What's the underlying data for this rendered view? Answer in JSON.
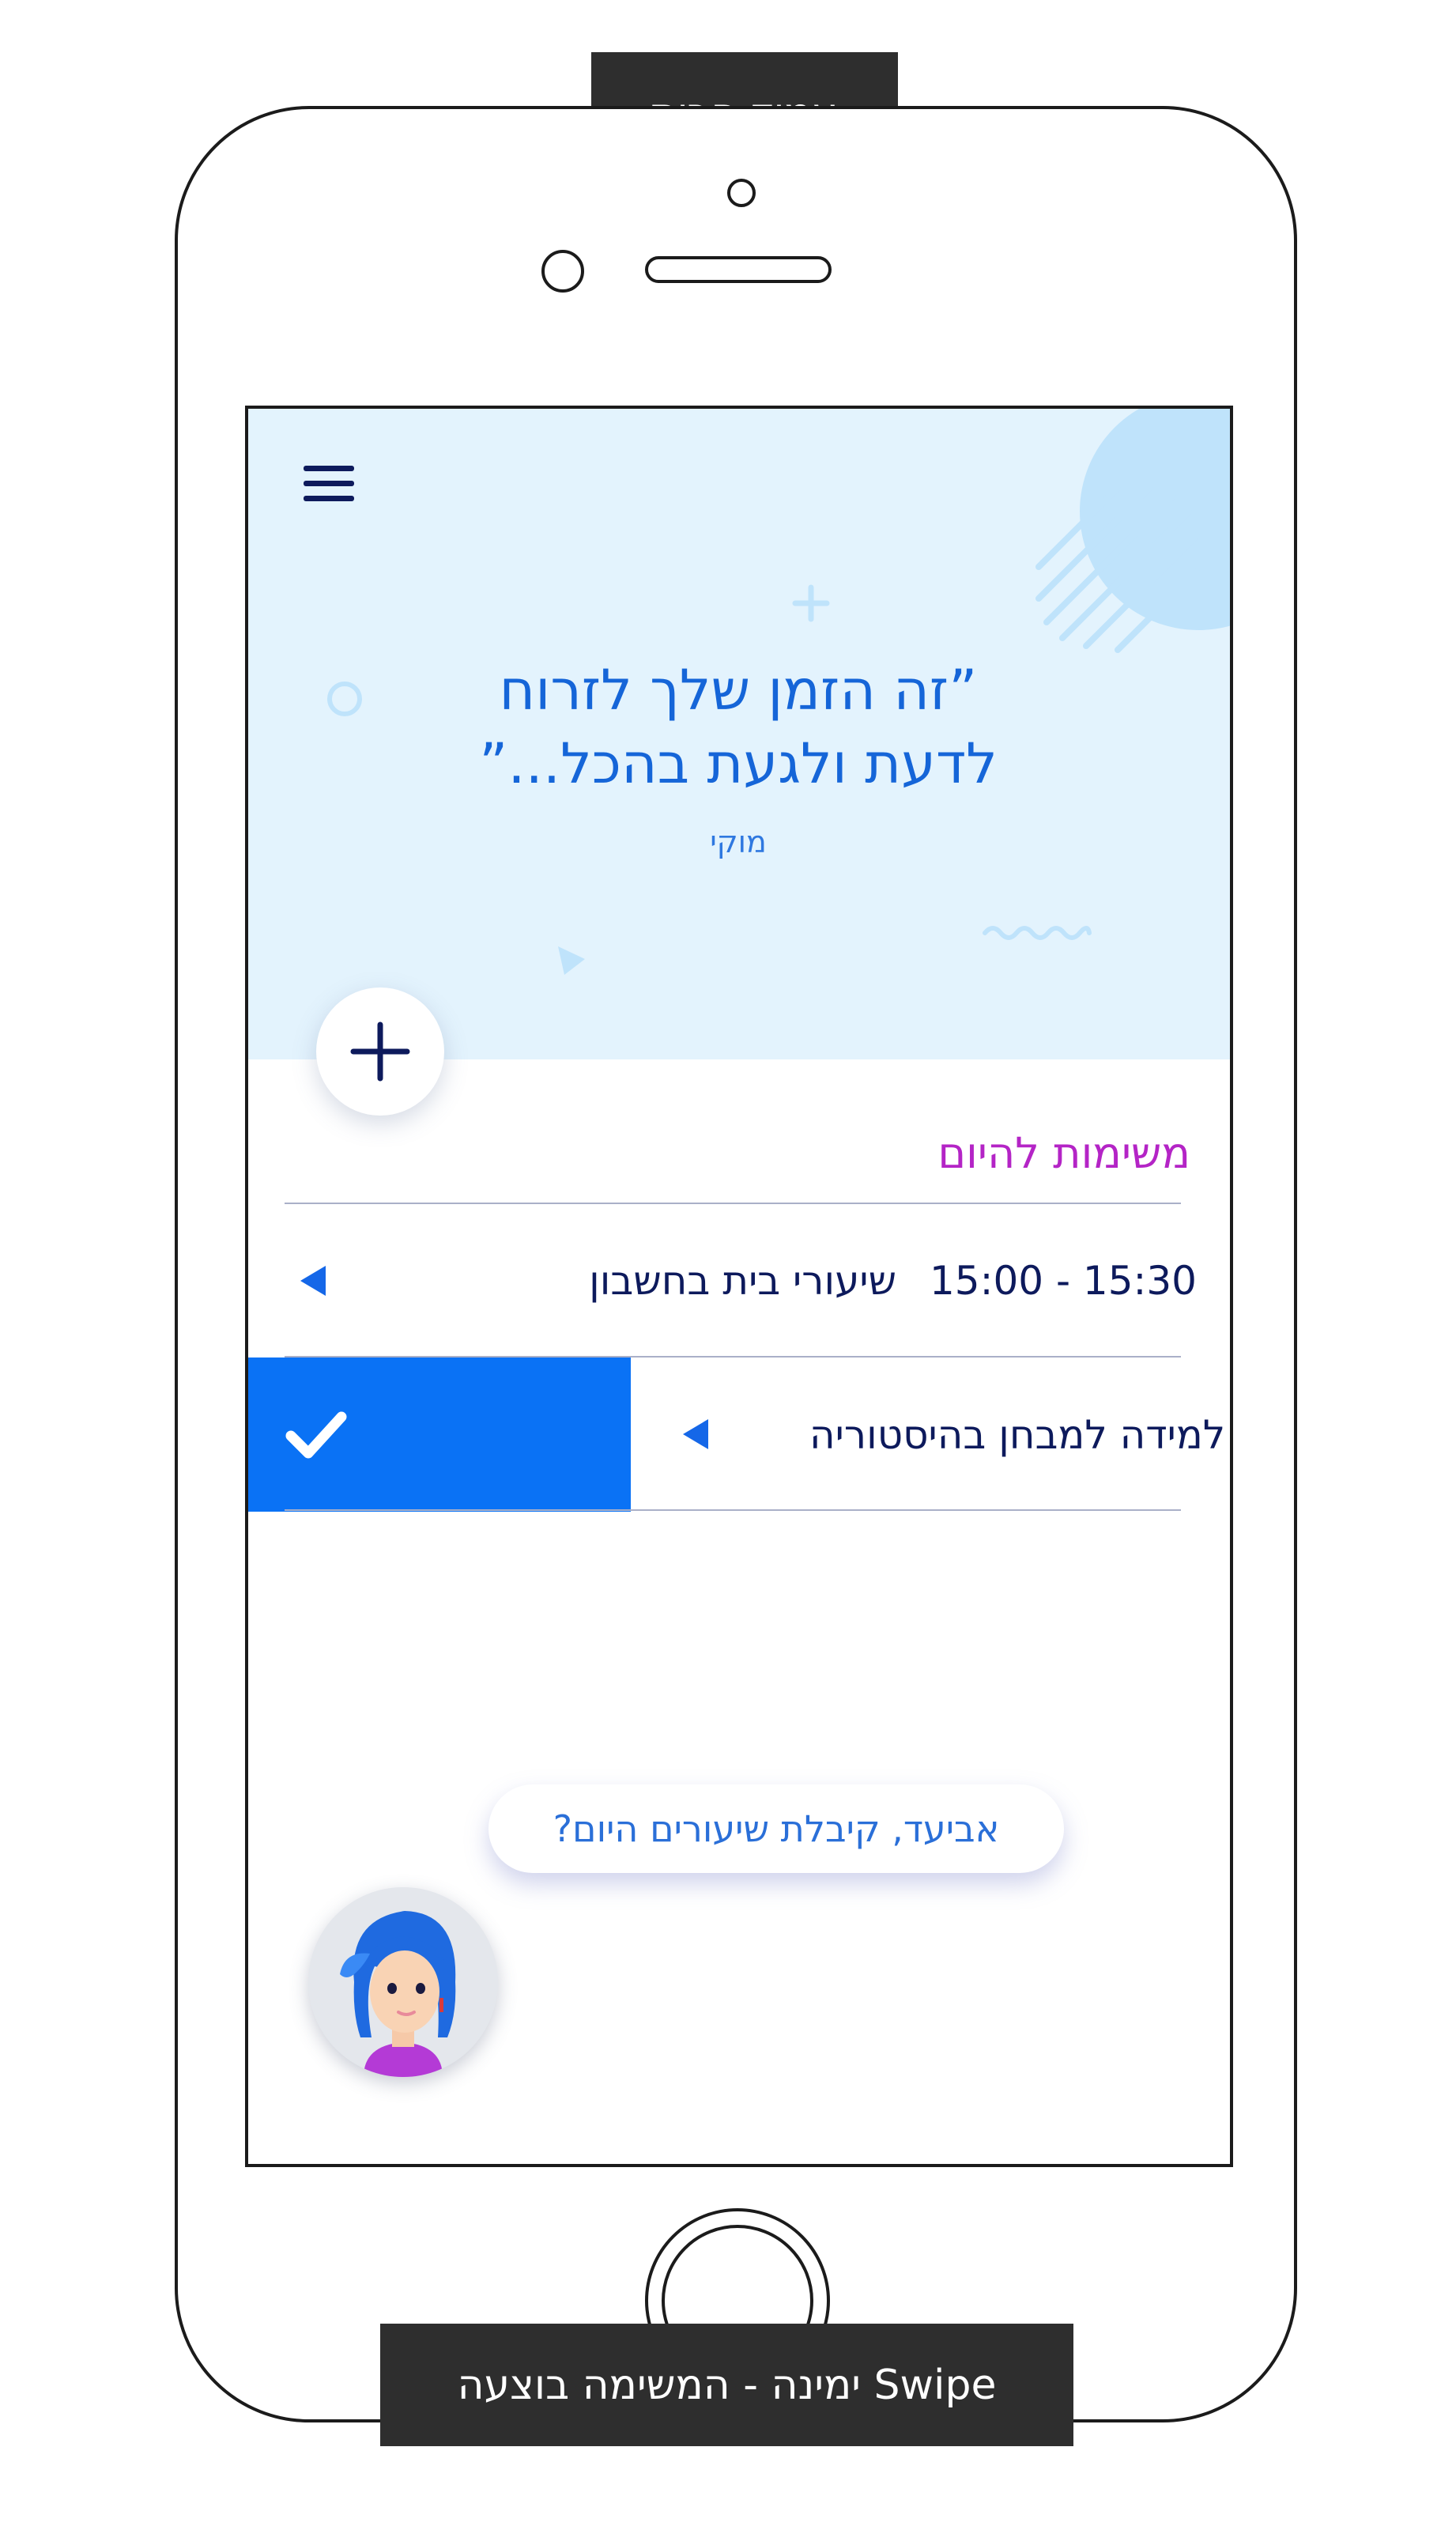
{
  "labels": {
    "top": "עמוד הבית",
    "bottom": "Swipe ימינה - המשימה בוצעה"
  },
  "hero": {
    "quote_line1": "”זה הזמן שלך לזרוח",
    "quote_line2": "לדעת ולגעת בהכל...”",
    "author": "מוקי"
  },
  "tasks_section": {
    "title": "משימות להיום",
    "tasks": [
      {
        "time": "15:00 - 15:30",
        "title": "שיעורי בית בחשבון"
      },
      {
        "title": "למידה למבחן בהיסטוריה",
        "state": "swiped-done"
      }
    ]
  },
  "assistant": {
    "message": "אביעד, קיבלת שיעורים היום?"
  },
  "colors": {
    "hero_bg": "#e3f3fd",
    "accent_blue": "#0a72f5",
    "title_purple": "#b424c6",
    "navy": "#0d1a5c"
  },
  "icons": [
    "menu-icon",
    "plus-icon",
    "chevron-left-icon",
    "check-icon",
    "avatar"
  ]
}
